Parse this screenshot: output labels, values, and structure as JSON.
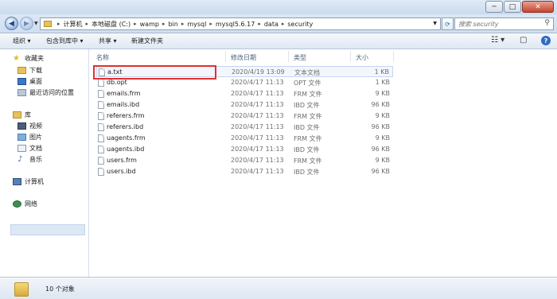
{
  "window": {
    "minimize": "─",
    "maximize": "□",
    "close": "✕"
  },
  "address": {
    "parts": [
      "计算机",
      "本地磁盘 (C:)",
      "wamp",
      "bin",
      "mysql",
      "mysql5.6.17",
      "data",
      "security"
    ],
    "separator": "▸"
  },
  "search": {
    "placeholder": "搜索 security"
  },
  "toolbar": {
    "organize": "组织 ▾",
    "include_library": "包含到库中 ▾",
    "share": "共享 ▾",
    "new_folder": "新建文件夹"
  },
  "nav": {
    "favorites": "收藏夹",
    "downloads": "下载",
    "desktop": "桌面",
    "recent": "最近访问的位置",
    "libraries": "库",
    "videos": "视频",
    "pictures": "图片",
    "documents": "文档",
    "music": "音乐",
    "computer": "计算机",
    "network": "网络"
  },
  "columns": {
    "name": "名称",
    "date": "修改日期",
    "type": "类型",
    "size": "大小"
  },
  "files": [
    {
      "name": "a.txt",
      "date": "2020/4/19 13:09",
      "type": "文本文档",
      "size": "1 KB"
    },
    {
      "name": "db.opt",
      "date": "2020/4/17 11:13",
      "type": "OPT 文件",
      "size": "1 KB"
    },
    {
      "name": "emails.frm",
      "date": "2020/4/17 11:13",
      "type": "FRM 文件",
      "size": "9 KB"
    },
    {
      "name": "emails.ibd",
      "date": "2020/4/17 11:13",
      "type": "IBD 文件",
      "size": "96 KB"
    },
    {
      "name": "referers.frm",
      "date": "2020/4/17 11:13",
      "type": "FRM 文件",
      "size": "9 KB"
    },
    {
      "name": "referers.ibd",
      "date": "2020/4/17 11:13",
      "type": "IBD 文件",
      "size": "96 KB"
    },
    {
      "name": "uagents.frm",
      "date": "2020/4/17 11:13",
      "type": "FRM 文件",
      "size": "9 KB"
    },
    {
      "name": "uagents.ibd",
      "date": "2020/4/17 11:13",
      "type": "IBD 文件",
      "size": "96 KB"
    },
    {
      "name": "users.frm",
      "date": "2020/4/17 11:13",
      "type": "FRM 文件",
      "size": "9 KB"
    },
    {
      "name": "users.ibd",
      "date": "2020/4/17 11:13",
      "type": "IBD 文件",
      "size": "96 KB"
    }
  ],
  "status": {
    "count": "10 个对象"
  }
}
